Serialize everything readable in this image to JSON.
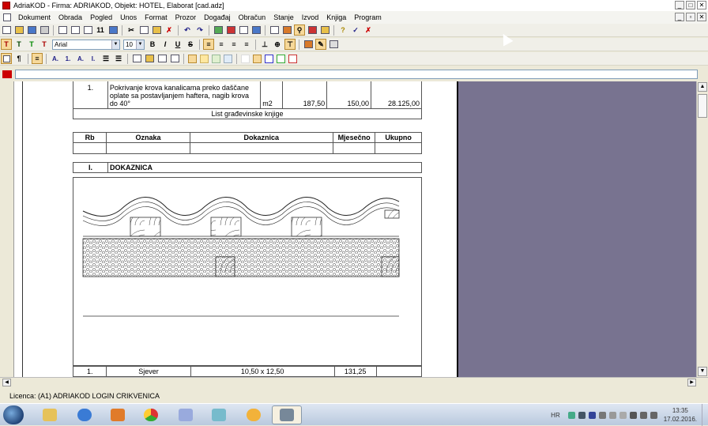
{
  "window": {
    "title": "AdriaKOD - Firma: ADRIAKOD,   Objekt: HOTEL, Elaborat [cad.adz]",
    "minimize": "_",
    "maximize": "□",
    "close": "✕"
  },
  "menu": [
    "Dokument",
    "Obrada",
    "Pogled",
    "Unos",
    "Format",
    "Prozor",
    "Događaj",
    "Obračun",
    "Stanje",
    "Izvod",
    "Knjiga",
    "Program"
  ],
  "format_toolbar": {
    "font_name": "Arial",
    "font_size": "10",
    "bold": "B",
    "italic": "I",
    "underline": "U",
    "strike": "S",
    "t_styles": [
      "T",
      "T",
      "T",
      "T"
    ]
  },
  "toolbar3": {
    "letter_buttons": [
      "A.",
      "1.",
      "A.",
      "I."
    ]
  },
  "document": {
    "item_row": {
      "rb": "1.",
      "description": "Pokrivanje krova kanalicama preko daščane oplate sa postavljanjem haftera, nagib krova do 40°",
      "unit": "m2",
      "qty": "187,50",
      "price": "150,00",
      "total": "28.125,00"
    },
    "caption": "List građevinske knjige",
    "headers": [
      "Rb",
      "Oznaka",
      "Dokaznica",
      "Mjesečno",
      "Ukupno"
    ],
    "section": {
      "number": "I.",
      "title": "DOKAZNICA"
    },
    "bottom_row": {
      "rb": "1.",
      "oznaka": "Sjever",
      "dokaznica": "10,50 x 12,50",
      "mjesecno": "131,25"
    }
  },
  "status": {
    "licence": "Licenca: (A1) ADRIAKOD LOGIN CRIKVENICA"
  },
  "taskbar": {
    "lang": "HR",
    "time": "13:35",
    "date": "17.02.2016."
  },
  "icons": {
    "app": "app-icon",
    "start": "windows-start-icon"
  }
}
